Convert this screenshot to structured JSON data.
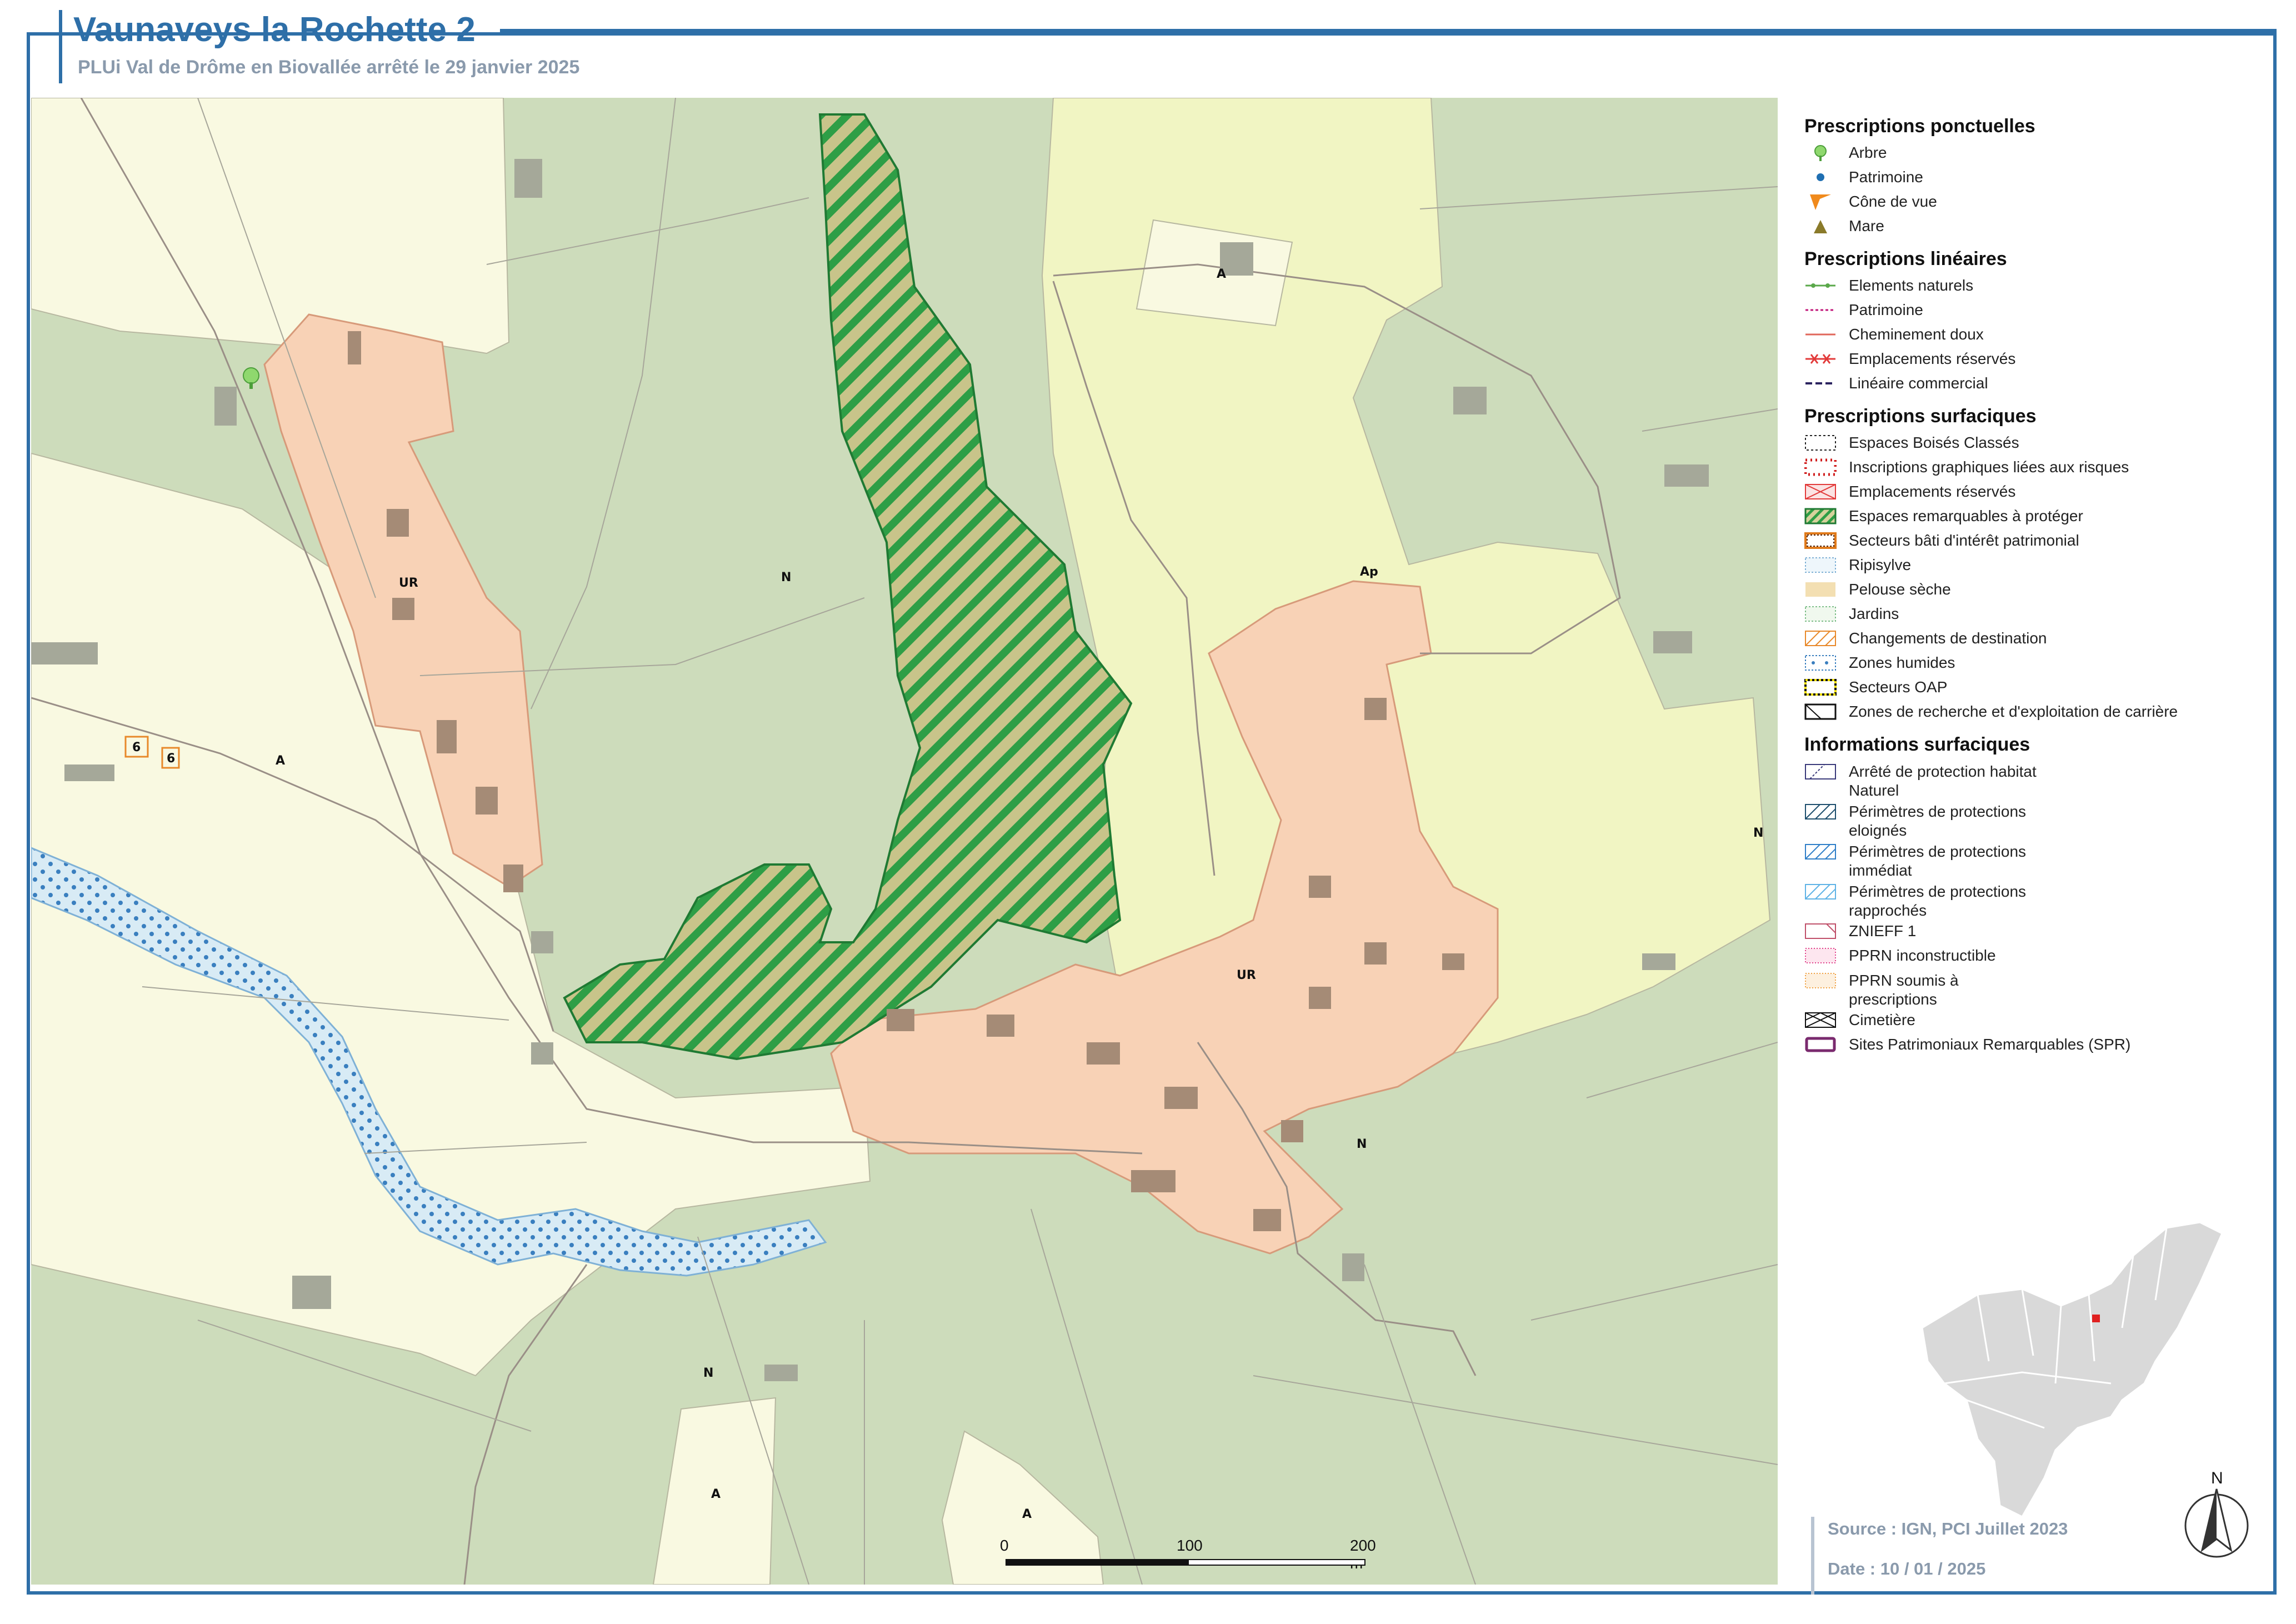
{
  "header": {
    "title": "Vaunaveys la Rochette 2",
    "subtitle": "PLUi Val de Drôme en Biovallée arrêté le 29 janvier 2025"
  },
  "colors": {
    "frame": "#2e6fa8",
    "zone_N": "#cddcbb",
    "zone_A": "#f9f9e1",
    "zone_Ap": "#f1f5c3",
    "zone_UR": "#f8d2b6",
    "protected_spaces": "#2e9e46",
    "river": "#cfe5f2"
  },
  "map": {
    "zone_labels": [
      {
        "id": "z1",
        "text": "UR"
      },
      {
        "id": "z2",
        "text": "A"
      },
      {
        "id": "z3",
        "text": "N"
      },
      {
        "id": "z4",
        "text": "A"
      },
      {
        "id": "z5",
        "text": "Ap"
      },
      {
        "id": "z6",
        "text": "N"
      },
      {
        "id": "z7",
        "text": "UR"
      },
      {
        "id": "z8",
        "text": "N"
      },
      {
        "id": "z9",
        "text": "N"
      },
      {
        "id": "z10",
        "text": "A"
      },
      {
        "id": "z11",
        "text": "A"
      }
    ],
    "change_of_destination_labels": [
      "6",
      "6"
    ]
  },
  "legend": {
    "ponctuelles": {
      "title": "Prescriptions ponctuelles",
      "items": [
        "Arbre",
        "Patrimoine",
        "Cône de vue",
        "Mare"
      ]
    },
    "lineaires": {
      "title": "Prescriptions linéaires",
      "items": [
        "Elements naturels",
        "Patrimoine",
        "Cheminement doux",
        "Emplacements réservés",
        "Linéaire commercial"
      ]
    },
    "surfaciques": {
      "title": "Prescriptions surfaciques",
      "items": [
        "Espaces Boisés Classés",
        "Inscriptions graphiques liées aux risques",
        "Emplacements réservés",
        "Espaces remarquables à protéger",
        "Secteurs bâti d'intérêt patrimonial",
        "Ripisylve",
        "Pelouse sèche",
        "Jardins",
        "Changements de destination",
        "Zones humides",
        "Secteurs OAP",
        "Zones de recherche et d'exploitation de carrière"
      ]
    },
    "informations": {
      "title": "Informations surfaciques",
      "items": [
        "Arrêté de protection habitat Naturel",
        "Périmètres de protections eloignés",
        "Périmètres de protections immédiat",
        "Périmètres de protections rapprochés",
        "ZNIEFF 1",
        "PPRN inconstructible",
        "PPRN soumis à prescriptions",
        "Cimetière",
        "Sites Patrimoniaux Remarquables (SPR)"
      ]
    }
  },
  "scale": {
    "labels": [
      "0",
      "100",
      "200 m"
    ]
  },
  "north_label": "N",
  "footer": {
    "source": "Source : IGN, PCI Juillet 2023",
    "date": "Date : 10 / 01 / 2025"
  }
}
